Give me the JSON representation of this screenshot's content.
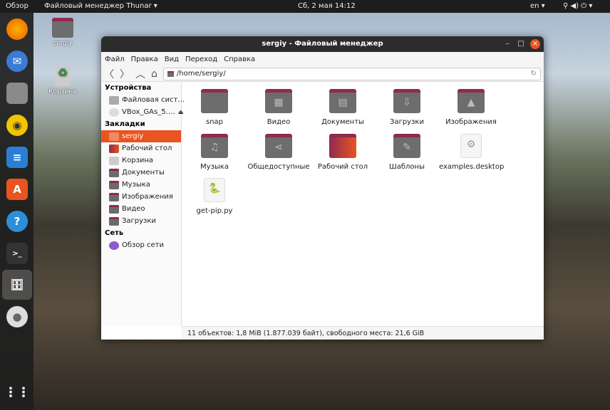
{
  "topbar": {
    "activities": "Обзор",
    "app_menu": "Файловый менеджер Thunar ▾",
    "clock": "Сб, 2 мая  14:12",
    "lang": "en ▾",
    "system": "⚲ ◀) ⏻ ▾"
  },
  "desktop": {
    "icons": [
      {
        "label": "sergiy"
      },
      {
        "label": "Корзина"
      }
    ]
  },
  "window": {
    "title": "sergiy - Файловый менеджер",
    "address": "/home/sergiy/",
    "menu": [
      "Файл",
      "Правка",
      "Вид",
      "Переход",
      "Справка"
    ],
    "sidebar": {
      "devices_header": "Устройства",
      "devices": [
        "Файловая сист…",
        "VBox_GAs_5.…"
      ],
      "bookmarks_header": "Закладки",
      "bookmarks": [
        "sergiy",
        "Рабочий стол",
        "Корзина",
        "Документы",
        "Музыка",
        "Изображения",
        "Видео",
        "Загрузки"
      ],
      "network_header": "Сеть",
      "network": [
        "Обзор сети"
      ]
    },
    "files": [
      "snap",
      "Видео",
      "Документы",
      "Загрузки",
      "Изображения",
      "Музыка",
      "Общедоступные",
      "Рабочий стол",
      "Шаблоны",
      "examples.desktop",
      "get-pip.py"
    ],
    "status": "11 объектов: 1,8 MiB (1.877.039 байт), свободного места: 21,6 GiB"
  },
  "colors": {
    "accent": "#e95420",
    "folder": "#6d6d6d",
    "folder_tab": "#8e2b4f"
  }
}
